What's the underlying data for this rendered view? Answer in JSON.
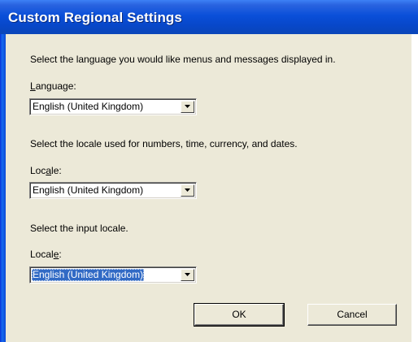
{
  "window": {
    "title": "Custom Regional Settings"
  },
  "language_section": {
    "description": "Select the language you would like menus and messages displayed in.",
    "label_pre": "",
    "label_accel": "L",
    "label_post": "anguage:",
    "selected_value": "English (United Kingdom)"
  },
  "locale_section": {
    "description": "Select the locale used for numbers, time, currency, and dates.",
    "label_pre": "Loc",
    "label_accel": "a",
    "label_post": "le:",
    "selected_value": "English (United Kingdom)"
  },
  "input_locale_section": {
    "description": "Select the input locale.",
    "label_pre": "Local",
    "label_accel": "e",
    "label_post": ":",
    "selected_value": "English (United Kingdom)"
  },
  "buttons": {
    "ok_label": "OK",
    "cancel_label": "Cancel"
  },
  "colors": {
    "titlebar": "#0a4fd9",
    "dialog_bg": "#ece9d8",
    "selection": "#316ac5"
  },
  "icons": {
    "dropdown": "chevron-down-icon"
  }
}
